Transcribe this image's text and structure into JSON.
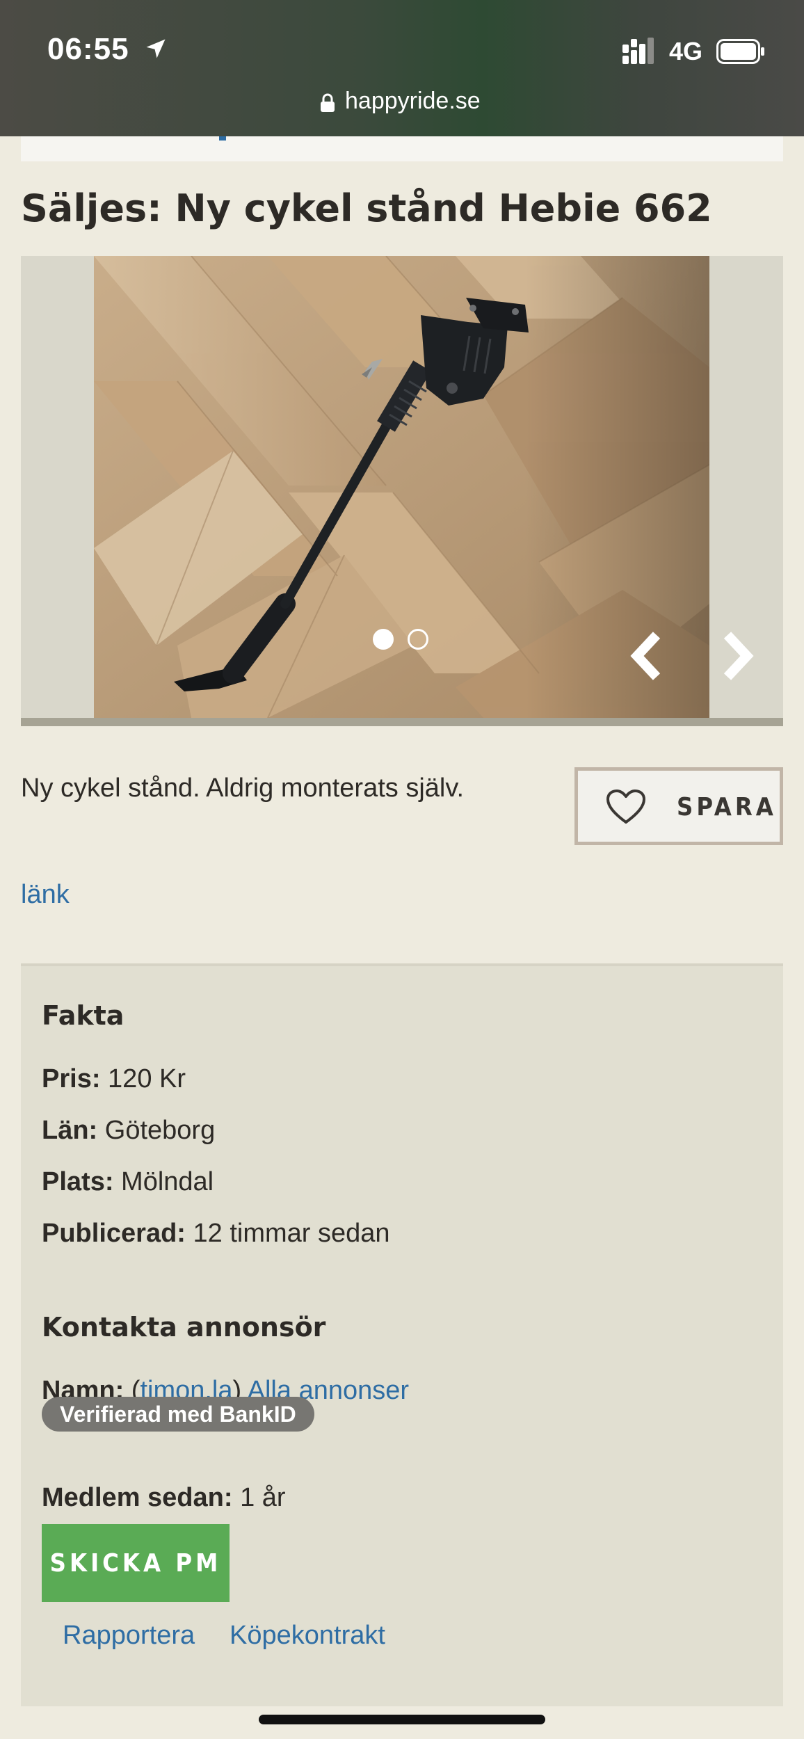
{
  "status_bar": {
    "time": "06:55",
    "network": "4G",
    "url": "happyride.se"
  },
  "listing": {
    "title": "Säljes: Ny cykel stånd Hebie 662",
    "description": "Ny cykel stånd. Aldrig monterats själv.",
    "save_label": "SPARA",
    "link_label": "länk",
    "gallery": {
      "image_count": 2,
      "active_index": 1
    }
  },
  "facts": {
    "heading": "Fakta",
    "rows": [
      {
        "label": "Pris:",
        "value": "120 Kr"
      },
      {
        "label": "Län:",
        "value": "Göteborg"
      },
      {
        "label": "Plats:",
        "value": "Mölndal"
      },
      {
        "label": "Publicerad:",
        "value": "12 timmar sedan"
      }
    ]
  },
  "contact": {
    "heading": "Kontakta annonsör",
    "name_label": "Namn:",
    "username": "timon.la",
    "all_ads_label": "Alla annonser",
    "verified_badge": "Verifierad med BankID",
    "member_label": "Medlem sedan:",
    "member_value": "1 år",
    "pm_button": "SKICKA PM",
    "report_label": "Rapportera",
    "contract_label": "Köpekontrakt"
  },
  "colors": {
    "accent_link": "#2e6da4",
    "pm_button": "#5aab55",
    "badge": "#777672",
    "page_bg": "#eeebdf",
    "facts_bg": "#e1dfd1"
  }
}
